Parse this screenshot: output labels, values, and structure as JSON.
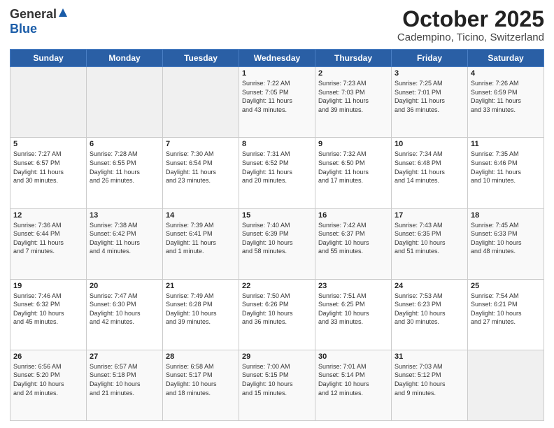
{
  "header": {
    "logo_general": "General",
    "logo_blue": "Blue",
    "month_title": "October 2025",
    "subtitle": "Cadempino, Ticino, Switzerland"
  },
  "weekdays": [
    "Sunday",
    "Monday",
    "Tuesday",
    "Wednesday",
    "Thursday",
    "Friday",
    "Saturday"
  ],
  "weeks": [
    [
      {
        "day": "",
        "detail": ""
      },
      {
        "day": "",
        "detail": ""
      },
      {
        "day": "",
        "detail": ""
      },
      {
        "day": "1",
        "detail": "Sunrise: 7:22 AM\nSunset: 7:05 PM\nDaylight: 11 hours\nand 43 minutes."
      },
      {
        "day": "2",
        "detail": "Sunrise: 7:23 AM\nSunset: 7:03 PM\nDaylight: 11 hours\nand 39 minutes."
      },
      {
        "day": "3",
        "detail": "Sunrise: 7:25 AM\nSunset: 7:01 PM\nDaylight: 11 hours\nand 36 minutes."
      },
      {
        "day": "4",
        "detail": "Sunrise: 7:26 AM\nSunset: 6:59 PM\nDaylight: 11 hours\nand 33 minutes."
      }
    ],
    [
      {
        "day": "5",
        "detail": "Sunrise: 7:27 AM\nSunset: 6:57 PM\nDaylight: 11 hours\nand 30 minutes."
      },
      {
        "day": "6",
        "detail": "Sunrise: 7:28 AM\nSunset: 6:55 PM\nDaylight: 11 hours\nand 26 minutes."
      },
      {
        "day": "7",
        "detail": "Sunrise: 7:30 AM\nSunset: 6:54 PM\nDaylight: 11 hours\nand 23 minutes."
      },
      {
        "day": "8",
        "detail": "Sunrise: 7:31 AM\nSunset: 6:52 PM\nDaylight: 11 hours\nand 20 minutes."
      },
      {
        "day": "9",
        "detail": "Sunrise: 7:32 AM\nSunset: 6:50 PM\nDaylight: 11 hours\nand 17 minutes."
      },
      {
        "day": "10",
        "detail": "Sunrise: 7:34 AM\nSunset: 6:48 PM\nDaylight: 11 hours\nand 14 minutes."
      },
      {
        "day": "11",
        "detail": "Sunrise: 7:35 AM\nSunset: 6:46 PM\nDaylight: 11 hours\nand 10 minutes."
      }
    ],
    [
      {
        "day": "12",
        "detail": "Sunrise: 7:36 AM\nSunset: 6:44 PM\nDaylight: 11 hours\nand 7 minutes."
      },
      {
        "day": "13",
        "detail": "Sunrise: 7:38 AM\nSunset: 6:42 PM\nDaylight: 11 hours\nand 4 minutes."
      },
      {
        "day": "14",
        "detail": "Sunrise: 7:39 AM\nSunset: 6:41 PM\nDaylight: 11 hours\nand 1 minute."
      },
      {
        "day": "15",
        "detail": "Sunrise: 7:40 AM\nSunset: 6:39 PM\nDaylight: 10 hours\nand 58 minutes."
      },
      {
        "day": "16",
        "detail": "Sunrise: 7:42 AM\nSunset: 6:37 PM\nDaylight: 10 hours\nand 55 minutes."
      },
      {
        "day": "17",
        "detail": "Sunrise: 7:43 AM\nSunset: 6:35 PM\nDaylight: 10 hours\nand 51 minutes."
      },
      {
        "day": "18",
        "detail": "Sunrise: 7:45 AM\nSunset: 6:33 PM\nDaylight: 10 hours\nand 48 minutes."
      }
    ],
    [
      {
        "day": "19",
        "detail": "Sunrise: 7:46 AM\nSunset: 6:32 PM\nDaylight: 10 hours\nand 45 minutes."
      },
      {
        "day": "20",
        "detail": "Sunrise: 7:47 AM\nSunset: 6:30 PM\nDaylight: 10 hours\nand 42 minutes."
      },
      {
        "day": "21",
        "detail": "Sunrise: 7:49 AM\nSunset: 6:28 PM\nDaylight: 10 hours\nand 39 minutes."
      },
      {
        "day": "22",
        "detail": "Sunrise: 7:50 AM\nSunset: 6:26 PM\nDaylight: 10 hours\nand 36 minutes."
      },
      {
        "day": "23",
        "detail": "Sunrise: 7:51 AM\nSunset: 6:25 PM\nDaylight: 10 hours\nand 33 minutes."
      },
      {
        "day": "24",
        "detail": "Sunrise: 7:53 AM\nSunset: 6:23 PM\nDaylight: 10 hours\nand 30 minutes."
      },
      {
        "day": "25",
        "detail": "Sunrise: 7:54 AM\nSunset: 6:21 PM\nDaylight: 10 hours\nand 27 minutes."
      }
    ],
    [
      {
        "day": "26",
        "detail": "Sunrise: 6:56 AM\nSunset: 5:20 PM\nDaylight: 10 hours\nand 24 minutes."
      },
      {
        "day": "27",
        "detail": "Sunrise: 6:57 AM\nSunset: 5:18 PM\nDaylight: 10 hours\nand 21 minutes."
      },
      {
        "day": "28",
        "detail": "Sunrise: 6:58 AM\nSunset: 5:17 PM\nDaylight: 10 hours\nand 18 minutes."
      },
      {
        "day": "29",
        "detail": "Sunrise: 7:00 AM\nSunset: 5:15 PM\nDaylight: 10 hours\nand 15 minutes."
      },
      {
        "day": "30",
        "detail": "Sunrise: 7:01 AM\nSunset: 5:14 PM\nDaylight: 10 hours\nand 12 minutes."
      },
      {
        "day": "31",
        "detail": "Sunrise: 7:03 AM\nSunset: 5:12 PM\nDaylight: 10 hours\nand 9 minutes."
      },
      {
        "day": "",
        "detail": ""
      }
    ]
  ]
}
